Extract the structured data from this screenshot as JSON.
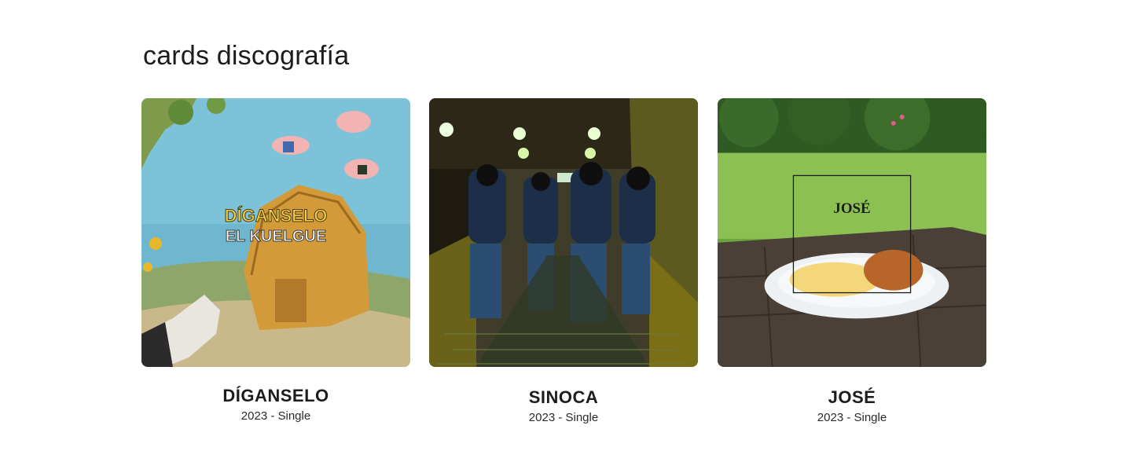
{
  "page": {
    "title": "cards discografía"
  },
  "cards": [
    {
      "title": "DÍGANSELO",
      "meta": "2023 - Single",
      "cover_text": [
        "DÍGANSELO",
        "EL KUELGUE"
      ]
    },
    {
      "title": "SINOCA",
      "meta": "2023 - Single"
    },
    {
      "title": "JOSÉ",
      "meta": "2023 - Single",
      "cover_text": [
        "JOSÉ"
      ]
    }
  ]
}
